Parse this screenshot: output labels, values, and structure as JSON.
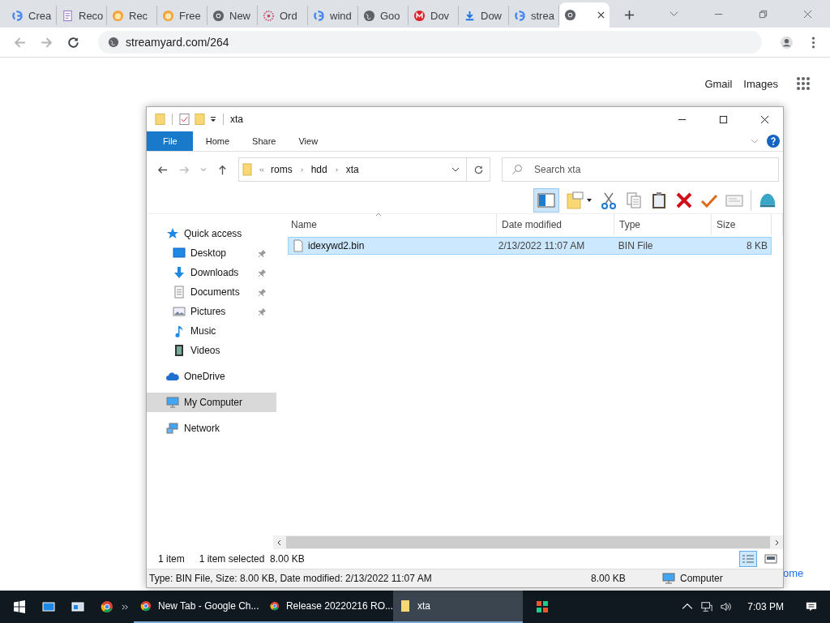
{
  "browser": {
    "tabs": [
      {
        "title": "Crea",
        "kind": "google",
        "selected": false
      },
      {
        "title": "Reco",
        "kind": "doc",
        "selected": false
      },
      {
        "title": "Rec",
        "kind": "orange",
        "selected": false
      },
      {
        "title": "Free",
        "kind": "orange",
        "selected": false
      },
      {
        "title": "New",
        "kind": "chrome",
        "selected": false
      },
      {
        "title": "Ord",
        "kind": "flower",
        "selected": false
      },
      {
        "title": "wind",
        "kind": "google",
        "selected": false
      },
      {
        "title": "Goo",
        "kind": "globe",
        "selected": false
      },
      {
        "title": "Dov",
        "kind": "mega",
        "selected": false
      },
      {
        "title": "Dow",
        "kind": "download",
        "selected": false
      },
      {
        "title": "strea",
        "kind": "google",
        "selected": false
      },
      {
        "kind": "chrome",
        "selected": true
      }
    ],
    "address": "streamyard.com/264"
  },
  "page": {
    "links": [
      "Gmail",
      "Images"
    ],
    "partial_link": "ome"
  },
  "explorer": {
    "title": "xta",
    "ribbon_tabs": [
      {
        "label": "File",
        "kind": "file"
      },
      {
        "label": "Home",
        "kind": "tab"
      },
      {
        "label": "Share",
        "kind": "tab"
      },
      {
        "label": "View",
        "kind": "tab"
      }
    ],
    "path": [
      "roms",
      "hdd",
      "xta"
    ],
    "search": {
      "placeholder": "Search xta"
    },
    "nav": [
      {
        "label": "Quick access",
        "kind": "star",
        "selected": false,
        "children": [
          {
            "label": "Desktop",
            "kind": "desktop",
            "pinned": true,
            "selected": false
          },
          {
            "label": "Downloads",
            "kind": "downloads",
            "pinned": true,
            "selected": false
          },
          {
            "label": "Documents",
            "kind": "documents",
            "pinned": true,
            "selected": false
          },
          {
            "label": "Pictures",
            "kind": "pictures",
            "pinned": true,
            "selected": false
          },
          {
            "label": "Music",
            "kind": "music",
            "pinned": false,
            "selected": false
          },
          {
            "label": "Videos",
            "kind": "videos",
            "pinned": false,
            "selected": false
          }
        ]
      },
      {
        "label": "OneDrive",
        "kind": "cloud",
        "selected": false
      },
      {
        "label": "My Computer",
        "kind": "computer",
        "selected": true
      },
      {
        "label": "Network",
        "kind": "network",
        "selected": false
      }
    ],
    "columns": [
      "Name",
      "Date modified",
      "Type",
      "Size"
    ],
    "rows": [
      {
        "name": "idexywd2.bin",
        "date": "2/13/2022 11:07 AM",
        "type": "BIN File",
        "size": "8 KB",
        "selected": true
      }
    ],
    "item_count": "1 item",
    "selection_info": "1 item selected  8.00 KB",
    "details": {
      "summary": "Type: BIN File, Size: 8.00 KB, Date modified: 2/13/2022 11:07 AM",
      "size": "8.00 KB",
      "location": "Computer"
    }
  },
  "taskbar": {
    "items": [
      {
        "label": "New Tab - Google Ch...",
        "kind": "chrome",
        "active": false
      },
      {
        "label": "Release 20220216 RO...",
        "kind": "chrome",
        "active": false
      },
      {
        "label": "xta",
        "kind": "folder",
        "active": true
      }
    ],
    "clock": "7:03 PM"
  }
}
